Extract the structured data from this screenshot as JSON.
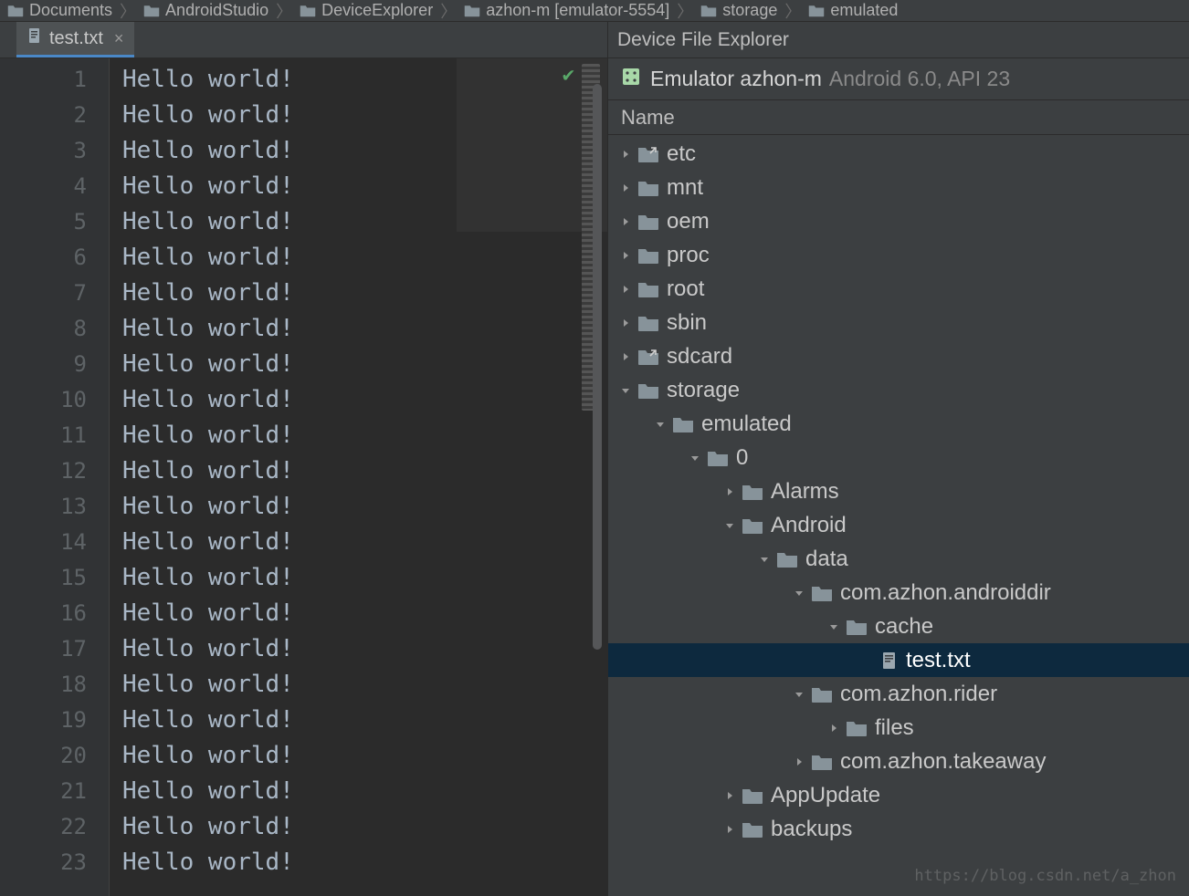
{
  "breadcrumb": [
    {
      "label": "Documents",
      "icon": "folder"
    },
    {
      "label": "AndroidStudio",
      "icon": "folder"
    },
    {
      "label": "DeviceExplorer",
      "icon": "folder"
    },
    {
      "label": "azhon-m [emulator-5554]",
      "icon": "folder"
    },
    {
      "label": "storage",
      "icon": "folder"
    },
    {
      "label": "emulated",
      "icon": "folder"
    }
  ],
  "tab": {
    "label": "test.txt"
  },
  "editor_line_text": "Hello world!",
  "editor_line_count": 23,
  "device_explorer": {
    "title": "Device File Explorer",
    "device_name": "Emulator azhon-m",
    "device_meta": "Android 6.0, API 23",
    "column_header": "Name",
    "tree": [
      {
        "depth": 0,
        "arrow": "right",
        "icon": "folder-link",
        "label": "etc"
      },
      {
        "depth": 0,
        "arrow": "right",
        "icon": "folder",
        "label": "mnt"
      },
      {
        "depth": 0,
        "arrow": "right",
        "icon": "folder",
        "label": "oem"
      },
      {
        "depth": 0,
        "arrow": "right",
        "icon": "folder",
        "label": "proc"
      },
      {
        "depth": 0,
        "arrow": "right",
        "icon": "folder",
        "label": "root"
      },
      {
        "depth": 0,
        "arrow": "right",
        "icon": "folder",
        "label": "sbin"
      },
      {
        "depth": 0,
        "arrow": "right",
        "icon": "folder-link",
        "label": "sdcard"
      },
      {
        "depth": 0,
        "arrow": "down",
        "icon": "folder",
        "label": "storage"
      },
      {
        "depth": 1,
        "arrow": "down",
        "icon": "folder",
        "label": "emulated"
      },
      {
        "depth": 2,
        "arrow": "down",
        "icon": "folder",
        "label": "0"
      },
      {
        "depth": 3,
        "arrow": "right",
        "icon": "folder",
        "label": "Alarms"
      },
      {
        "depth": 3,
        "arrow": "down",
        "icon": "folder",
        "label": "Android"
      },
      {
        "depth": 4,
        "arrow": "down",
        "icon": "folder",
        "label": "data"
      },
      {
        "depth": 5,
        "arrow": "down",
        "icon": "folder",
        "label": "com.azhon.androiddir"
      },
      {
        "depth": 6,
        "arrow": "down",
        "icon": "folder",
        "label": "cache"
      },
      {
        "depth": 7,
        "arrow": "none",
        "icon": "file",
        "label": "test.txt",
        "selected": true
      },
      {
        "depth": 5,
        "arrow": "down",
        "icon": "folder",
        "label": "com.azhon.rider"
      },
      {
        "depth": 6,
        "arrow": "right",
        "icon": "folder",
        "label": "files"
      },
      {
        "depth": 5,
        "arrow": "right",
        "icon": "folder",
        "label": "com.azhon.takeaway"
      },
      {
        "depth": 3,
        "arrow": "right",
        "icon": "folder",
        "label": "AppUpdate"
      },
      {
        "depth": 3,
        "arrow": "right",
        "icon": "folder",
        "label": "backups"
      }
    ]
  },
  "watermark": "https://blog.csdn.net/a_zhon"
}
